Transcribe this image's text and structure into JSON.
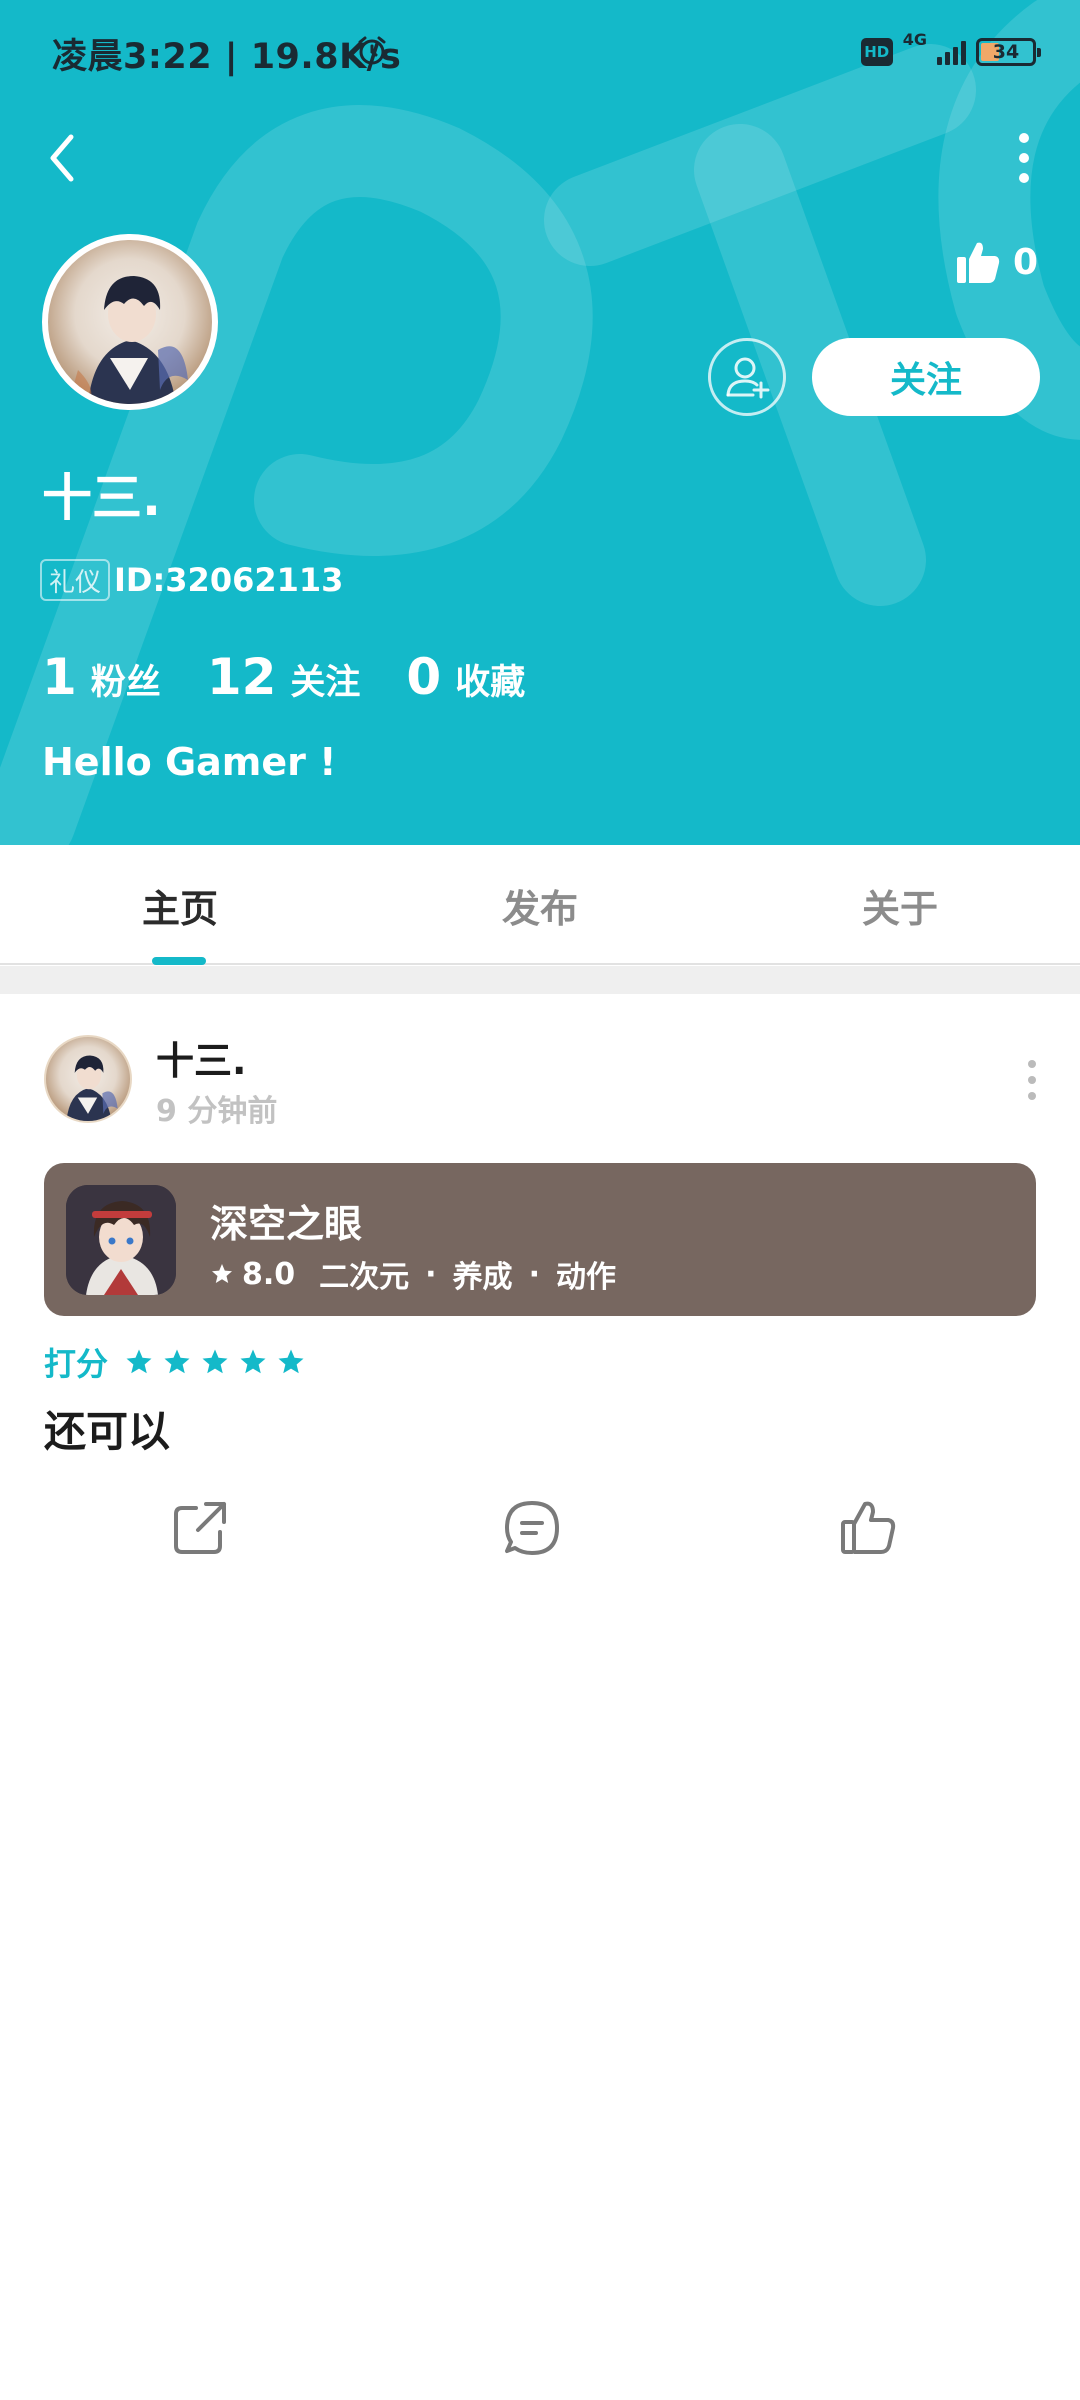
{
  "status_bar": {
    "time": "凌晨3:22 | 19.8K/s",
    "hd": "HD",
    "network": "4G",
    "battery": "34"
  },
  "header": {
    "like_count": "0",
    "follow_label": "关注"
  },
  "profile": {
    "username": "十三.",
    "title_badge": "礼仪",
    "user_id": "ID:32062113",
    "stats": [
      {
        "value": "1",
        "label": "粉丝"
      },
      {
        "value": "12",
        "label": "关注"
      },
      {
        "value": "0",
        "label": "收藏"
      }
    ],
    "bio": "Hello Gamer !"
  },
  "tabs": [
    {
      "label": "主页",
      "active": true
    },
    {
      "label": "发布",
      "active": false
    },
    {
      "label": "关于",
      "active": false
    }
  ],
  "post": {
    "author": "十三.",
    "time": "9 分钟前",
    "game": {
      "title": "深空之眼",
      "rating": "8.0",
      "tags": [
        "二次元",
        "养成",
        "动作"
      ]
    },
    "rating_label": "打分",
    "stars": 5,
    "review": "还可以"
  },
  "colors": {
    "accent": "#14b9c9",
    "card_bg": "#776760"
  },
  "icons": [
    "back-arrow-icon",
    "more-vertical-icon",
    "thumbs-up-icon",
    "add-friend-icon",
    "star-icon",
    "share-icon",
    "comment-icon",
    "like-icon"
  ]
}
